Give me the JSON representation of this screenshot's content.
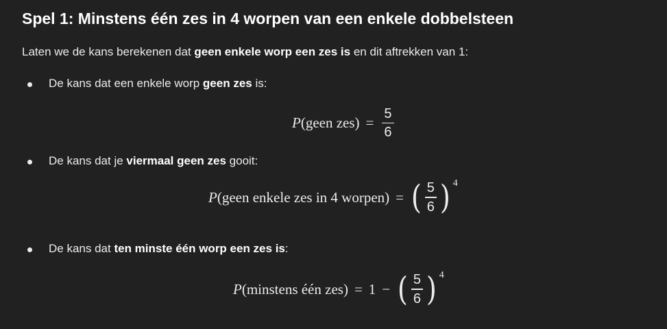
{
  "heading": "Spel 1: Minstens één zes in 4 worpen van een enkele dobbelsteen",
  "intro": {
    "pre": "Laten we de kans berekenen dat ",
    "bold": "geen enkele worp een zes is",
    "post": " en dit aftrekken van 1:"
  },
  "bullets": [
    {
      "pre": "De kans dat een enkele worp ",
      "bold": "geen zes",
      "post": " is:",
      "formula": {
        "P": "P",
        "arg": "(geen zes)",
        "eq": "=",
        "num": "5",
        "den": "6"
      }
    },
    {
      "pre": "De kans dat je ",
      "bold": "viermaal geen zes",
      "post": " gooit:",
      "formula": {
        "P": "P",
        "arg": "(geen enkele zes in 4 worpen)",
        "eq": "=",
        "lparen": "(",
        "num": "5",
        "den": "6",
        "rparen": ")",
        "exp": "4"
      }
    },
    {
      "pre": "De kans dat ",
      "bold": "ten minste één worp een zes is",
      "post": ":",
      "formula": {
        "P": "P",
        "arg": "(minstens één zes)",
        "eq": "=",
        "one": "1",
        "minus": "−",
        "lparen": "(",
        "num": "5",
        "den": "6",
        "rparen": ")",
        "exp": "4"
      }
    }
  ]
}
